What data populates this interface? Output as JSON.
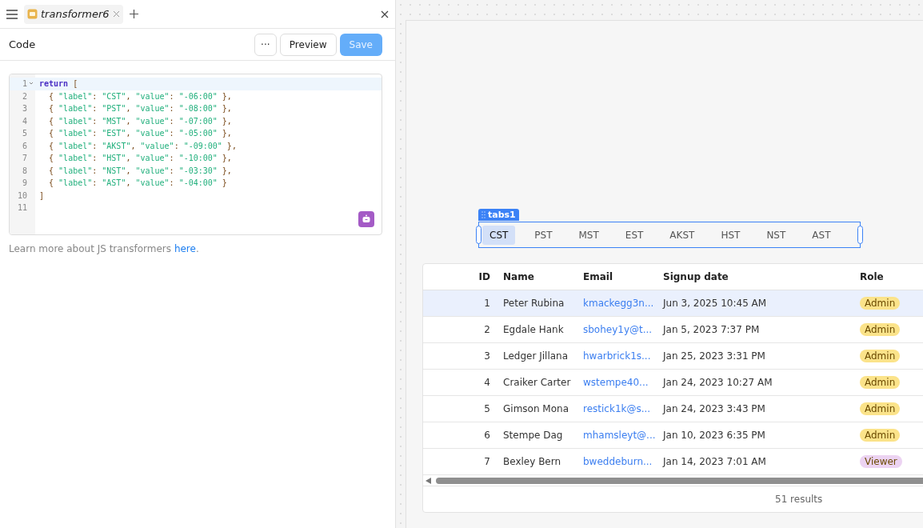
{
  "editor_tabs": [
    {
      "label": "transformer6",
      "selected": true
    }
  ],
  "panel": {
    "title": "Code",
    "buttons": [
      {
        "kind": "more",
        "label": "···"
      },
      {
        "kind": "secondary",
        "label": "Preview"
      },
      {
        "kind": "primary",
        "label": "Save",
        "disabled": true
      }
    ]
  },
  "code": {
    "lines": [
      [
        {
          "kind": "keyword",
          "text": "return"
        },
        {
          "kind": "punct",
          "text": " ["
        }
      ],
      [
        {
          "kind": "punct",
          "text": "  { "
        },
        {
          "kind": "string",
          "text": "\"label\""
        },
        {
          "kind": "punct",
          "text": ": "
        },
        {
          "kind": "string",
          "text": "\"CST\""
        },
        {
          "kind": "punct",
          "text": ", "
        },
        {
          "kind": "string",
          "text": "\"value\""
        },
        {
          "kind": "punct",
          "text": ": "
        },
        {
          "kind": "string",
          "text": "\"-06:00\""
        },
        {
          "kind": "punct",
          "text": " },"
        }
      ],
      [
        {
          "kind": "punct",
          "text": "  { "
        },
        {
          "kind": "string",
          "text": "\"label\""
        },
        {
          "kind": "punct",
          "text": ": "
        },
        {
          "kind": "string",
          "text": "\"PST\""
        },
        {
          "kind": "punct",
          "text": ", "
        },
        {
          "kind": "string",
          "text": "\"value\""
        },
        {
          "kind": "punct",
          "text": ": "
        },
        {
          "kind": "string",
          "text": "\"-08:00\""
        },
        {
          "kind": "punct",
          "text": " },"
        }
      ],
      [
        {
          "kind": "punct",
          "text": "  { "
        },
        {
          "kind": "string",
          "text": "\"label\""
        },
        {
          "kind": "punct",
          "text": ": "
        },
        {
          "kind": "string",
          "text": "\"MST\""
        },
        {
          "kind": "punct",
          "text": ", "
        },
        {
          "kind": "string",
          "text": "\"value\""
        },
        {
          "kind": "punct",
          "text": ": "
        },
        {
          "kind": "string",
          "text": "\"-07:00\""
        },
        {
          "kind": "punct",
          "text": " },"
        }
      ],
      [
        {
          "kind": "punct",
          "text": "  { "
        },
        {
          "kind": "string",
          "text": "\"label\""
        },
        {
          "kind": "punct",
          "text": ": "
        },
        {
          "kind": "string",
          "text": "\"EST\""
        },
        {
          "kind": "punct",
          "text": ", "
        },
        {
          "kind": "string",
          "text": "\"value\""
        },
        {
          "kind": "punct",
          "text": ": "
        },
        {
          "kind": "string",
          "text": "\"-05:00\""
        },
        {
          "kind": "punct",
          "text": " },"
        }
      ],
      [
        {
          "kind": "punct",
          "text": "  { "
        },
        {
          "kind": "string",
          "text": "\"label\""
        },
        {
          "kind": "punct",
          "text": ": "
        },
        {
          "kind": "string",
          "text": "\"AKST\""
        },
        {
          "kind": "punct",
          "text": ", "
        },
        {
          "kind": "string",
          "text": "\"value\""
        },
        {
          "kind": "punct",
          "text": ": "
        },
        {
          "kind": "string",
          "text": "\"-09:00\""
        },
        {
          "kind": "punct",
          "text": " },"
        }
      ],
      [
        {
          "kind": "punct",
          "text": "  { "
        },
        {
          "kind": "string",
          "text": "\"label\""
        },
        {
          "kind": "punct",
          "text": ": "
        },
        {
          "kind": "string",
          "text": "\"HST\""
        },
        {
          "kind": "punct",
          "text": ", "
        },
        {
          "kind": "string",
          "text": "\"value\""
        },
        {
          "kind": "punct",
          "text": ": "
        },
        {
          "kind": "string",
          "text": "\"-10:00\""
        },
        {
          "kind": "punct",
          "text": " },"
        }
      ],
      [
        {
          "kind": "punct",
          "text": "  { "
        },
        {
          "kind": "string",
          "text": "\"label\""
        },
        {
          "kind": "punct",
          "text": ": "
        },
        {
          "kind": "string",
          "text": "\"NST\""
        },
        {
          "kind": "punct",
          "text": ", "
        },
        {
          "kind": "string",
          "text": "\"value\""
        },
        {
          "kind": "punct",
          "text": ": "
        },
        {
          "kind": "string",
          "text": "\"-03:30\""
        },
        {
          "kind": "punct",
          "text": " },"
        }
      ],
      [
        {
          "kind": "punct",
          "text": "  { "
        },
        {
          "kind": "string",
          "text": "\"label\""
        },
        {
          "kind": "punct",
          "text": ": "
        },
        {
          "kind": "string",
          "text": "\"AST\""
        },
        {
          "kind": "punct",
          "text": ", "
        },
        {
          "kind": "string",
          "text": "\"value\""
        },
        {
          "kind": "punct",
          "text": ": "
        },
        {
          "kind": "string",
          "text": "\"-04:00\""
        },
        {
          "kind": "punct",
          "text": " }"
        }
      ],
      [
        {
          "kind": "punct",
          "text": "]"
        }
      ]
    ],
    "line_numbers": [
      "1",
      "2",
      "3",
      "4",
      "5",
      "6",
      "7",
      "8",
      "9",
      "10",
      "11"
    ]
  },
  "help": {
    "text": "Learn more about JS transformers ",
    "link": "here",
    "end": "."
  },
  "component_label": "tabs1",
  "tabs": [
    {
      "label": "CST",
      "selected": true
    },
    {
      "label": "PST",
      "selected": false
    },
    {
      "label": "MST",
      "selected": false
    },
    {
      "label": "EST",
      "selected": false
    },
    {
      "label": "AKST",
      "selected": false
    },
    {
      "label": "HST",
      "selected": false
    },
    {
      "label": "NST",
      "selected": false
    },
    {
      "label": "AST",
      "selected": false
    }
  ],
  "table": {
    "columns": [
      "ID",
      "Name",
      "Email",
      "Signup date",
      "Role"
    ],
    "rows": [
      {
        "id": "1",
        "name": "Peter Rubina",
        "email": "kmackegg3n...",
        "date": "Jun 3, 2025 10:45 AM",
        "role": "Admin",
        "color": "#fbe38a",
        "selected": true
      },
      {
        "id": "2",
        "name": "Egdale Hank",
        "email": "sbohey1y@t...",
        "date": "Jan 5, 2023 7:37 PM",
        "role": "Admin",
        "color": "#fbe38a",
        "selected": false
      },
      {
        "id": "3",
        "name": "Ledger Jillana",
        "email": "hwarbrick1s...",
        "date": "Jan 25, 2023 3:31 PM",
        "role": "Admin",
        "color": "#fbe38a",
        "selected": false
      },
      {
        "id": "4",
        "name": "Craiker Carter",
        "email": "wstempe40...",
        "date": "Jan 24, 2023 10:27 AM",
        "role": "Admin",
        "color": "#fbe38a",
        "selected": false
      },
      {
        "id": "5",
        "name": "Gimson Mona",
        "email": "restick1k@s...",
        "date": "Jan 24, 2023 3:43 PM",
        "role": "Admin",
        "color": "#fbe38a",
        "selected": false
      },
      {
        "id": "6",
        "name": "Stempe Dag",
        "email": "mhamsleyt@...",
        "date": "Jan 10, 2023 6:35 PM",
        "role": "Admin",
        "color": "#fbe38a",
        "selected": false
      },
      {
        "id": "7",
        "name": "Bexley Bern",
        "email": "bweddeburn...",
        "date": "Jan 14, 2023 7:01 AM",
        "role": "Viewer",
        "color": "#ecd3f2",
        "selected": false
      }
    ],
    "footer": "51 results"
  }
}
